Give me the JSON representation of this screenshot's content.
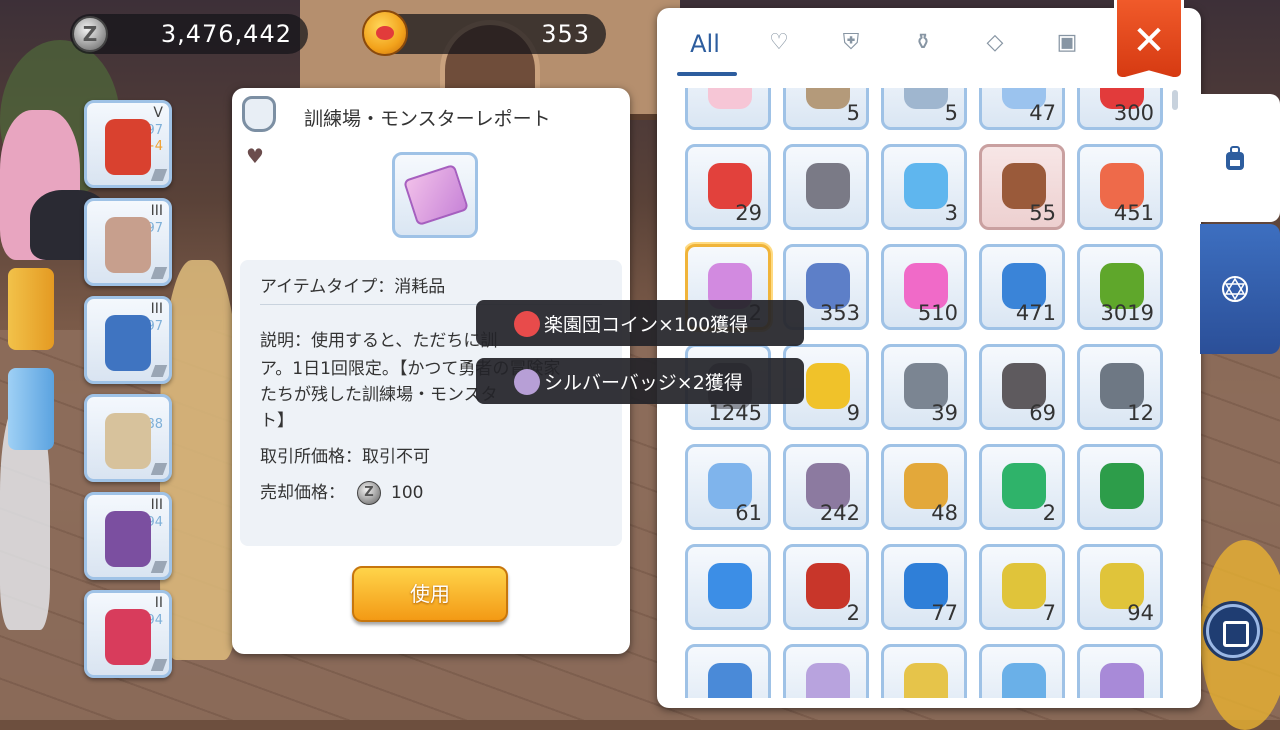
{
  "currency": {
    "zeny": "3,476,442",
    "cat_coins": "353"
  },
  "inventory_tabs": {
    "all": "All",
    "icons": [
      "heart-icon",
      "armor-icon",
      "potion-icon",
      "gem-icon",
      "card-icon"
    ]
  },
  "close_label": "✕",
  "equipment": [
    {
      "tier": "V",
      "level": "97",
      "plus": "+4",
      "icon": "necklace-icon",
      "color": "#d9412f"
    },
    {
      "tier": "III",
      "level": "97",
      "plus": "",
      "icon": "bodysuit-icon",
      "color": "#c79f8d"
    },
    {
      "tier": "III",
      "level": "97",
      "plus": "",
      "icon": "cloak-icon",
      "color": "#3f74c1"
    },
    {
      "tier": "",
      "level": "88",
      "plus": "",
      "icon": "boots-icon",
      "color": "#d7c29c"
    },
    {
      "tier": "III",
      "level": "94",
      "plus": "",
      "icon": "amulet-icon",
      "color": "#7b4fa0"
    },
    {
      "tier": "II",
      "level": "94",
      "plus": "",
      "icon": "heart-brooch-icon",
      "color": "#d83c5c"
    }
  ],
  "detail": {
    "title": "訓練場・モンスターレポート",
    "item_type": "アイテムタイプ：消耗品",
    "description_lines": [
      "説明：使用すると、ただちに訓",
      "ア。1日1回限定。【かつて勇者の冒険家",
      "たちが残した訓練場・モンスタ",
      "ト】"
    ],
    "exchange_price": "取引所価格：取引不可",
    "sell_label": "売却価格：",
    "sell_value": "100",
    "use_button": "使用"
  },
  "tooltips": [
    {
      "text": "楽園団コイン×100獲得",
      "icon_color": "#e84b4b"
    },
    {
      "text": "シルバーバッジ×2獲得",
      "icon_color": "#b79fd6"
    }
  ],
  "inventory": [
    {
      "qty": "",
      "icon": "pink-orb-icon",
      "color": "#f6c6d6"
    },
    {
      "qty": "5",
      "icon": "stick-icon",
      "color": "#b49a7a"
    },
    {
      "qty": "5",
      "icon": "wand-icon",
      "color": "#9fb6cf"
    },
    {
      "qty": "47",
      "icon": "crystal-shards-icon",
      "color": "#9bc3ee"
    },
    {
      "qty": "300",
      "icon": "red-ribbon-icon",
      "color": "#e23b3b"
    },
    {
      "qty": "29",
      "icon": "red-potion-icon",
      "color": "#e2413c"
    },
    {
      "qty": "",
      "icon": "dagger-icon",
      "color": "#7a7a86"
    },
    {
      "qty": "3",
      "icon": "ice-staff-icon",
      "color": "#5fb6ee"
    },
    {
      "qty": "55",
      "icon": "banned-branch-icon",
      "color": "#9a5a3a"
    },
    {
      "qty": "451",
      "icon": "red-ticket-icon",
      "color": "#ee6a4a"
    },
    {
      "qty": "2",
      "icon": "pink-scroll-icon",
      "color": "#d28ae0"
    },
    {
      "qty": "353",
      "icon": "blue-map-icon",
      "color": "#5d7fc8"
    },
    {
      "qty": "510",
      "icon": "pink-ticket-icon",
      "color": "#f06ac8"
    },
    {
      "qty": "471",
      "icon": "blue-ticket-icon",
      "color": "#3a84d8"
    },
    {
      "qty": "3019",
      "icon": "green-orb-icon",
      "color": "#5fa72b"
    },
    {
      "qty": "1245",
      "icon": "grey-orb-icon",
      "color": "#8b8f99"
    },
    {
      "qty": "9",
      "icon": "yellow-gem-icon",
      "color": "#f0c22a"
    },
    {
      "qty": "39",
      "icon": "grey-ore-icon",
      "color": "#7b8592"
    },
    {
      "qty": "69",
      "icon": "dark-stone-icon",
      "color": "#5e5a5e"
    },
    {
      "qty": "12",
      "icon": "small-stone-icon",
      "color": "#6e7884"
    },
    {
      "qty": "61",
      "icon": "ice-crystal-icon",
      "color": "#7fb4ec"
    },
    {
      "qty": "242",
      "icon": "purple-stone-icon",
      "color": "#8c7aa0"
    },
    {
      "qty": "48",
      "icon": "gold-ticket-icon",
      "color": "#e3a83a"
    },
    {
      "qty": "2",
      "icon": "sagittarius-stone-icon",
      "color": "#2fb36a"
    },
    {
      "qty": "",
      "icon": "virgo-stone-icon",
      "color": "#2d9d4a"
    },
    {
      "qty": "",
      "icon": "blue-star-icon",
      "color": "#3c8ee6"
    },
    {
      "qty": "2",
      "icon": "skull-bottle-icon",
      "color": "#c8362a"
    },
    {
      "qty": "77",
      "icon": "blue-crystal-icon",
      "color": "#2f7fd8"
    },
    {
      "qty": "7",
      "icon": "fruit-icon",
      "color": "#e0c43a"
    },
    {
      "qty": "94",
      "icon": "fruit-icon",
      "color": "#e0c43a"
    },
    {
      "qty": "",
      "icon": "blue-card-icon",
      "color": "#4a8ad8"
    },
    {
      "qty": "",
      "icon": "silver-badge-icon",
      "color": "#b8a3de"
    },
    {
      "qty": "",
      "icon": "character-card-icon",
      "color": "#e6c44a"
    },
    {
      "qty": "",
      "icon": "character-card-icon",
      "color": "#6ab0e8"
    },
    {
      "qty": "",
      "icon": "mirror-icon",
      "color": "#a88ad8"
    }
  ]
}
